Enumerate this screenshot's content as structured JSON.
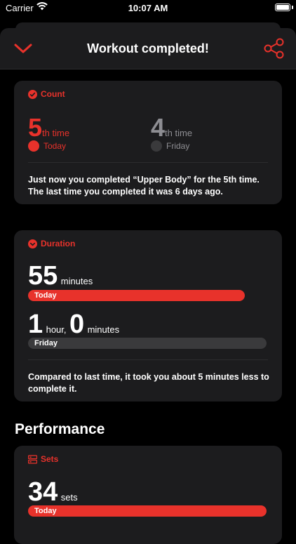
{
  "status_bar": {
    "carrier": "Carrier",
    "time": "10:07 AM"
  },
  "header": {
    "title": "Workout completed!"
  },
  "count_card": {
    "label": "Count",
    "current": {
      "number": "5",
      "suffix": "th time",
      "day": "Today"
    },
    "previous": {
      "number": "4",
      "suffix": "th time",
      "day": "Friday"
    },
    "note": "Just now you completed “Upper Body” for the 5th time. The last time you completed it was 6 days ago."
  },
  "duration_card": {
    "label": "Duration",
    "current": {
      "number": "55",
      "unit": "minutes",
      "bar_label": "Today"
    },
    "previous": {
      "hours": "1",
      "hours_unit": "hour,",
      "minutes": "0",
      "minutes_unit": "minutes",
      "bar_label": "Friday"
    },
    "note": "Compared to last time, it took you about 5 minutes less to complete it."
  },
  "performance": {
    "title": "Performance",
    "sets_card": {
      "label": "Sets",
      "number": "34",
      "unit": "sets",
      "bar_label": "Today"
    }
  },
  "colors": {
    "accent": "#e8322b",
    "card": "#1c1c1e",
    "muted": "#8e8e93"
  },
  "icons": [
    "wifi-icon",
    "battery-icon",
    "chevron-down-icon",
    "share-icon",
    "check-circle-icon",
    "clock-icon",
    "sets-icon"
  ]
}
